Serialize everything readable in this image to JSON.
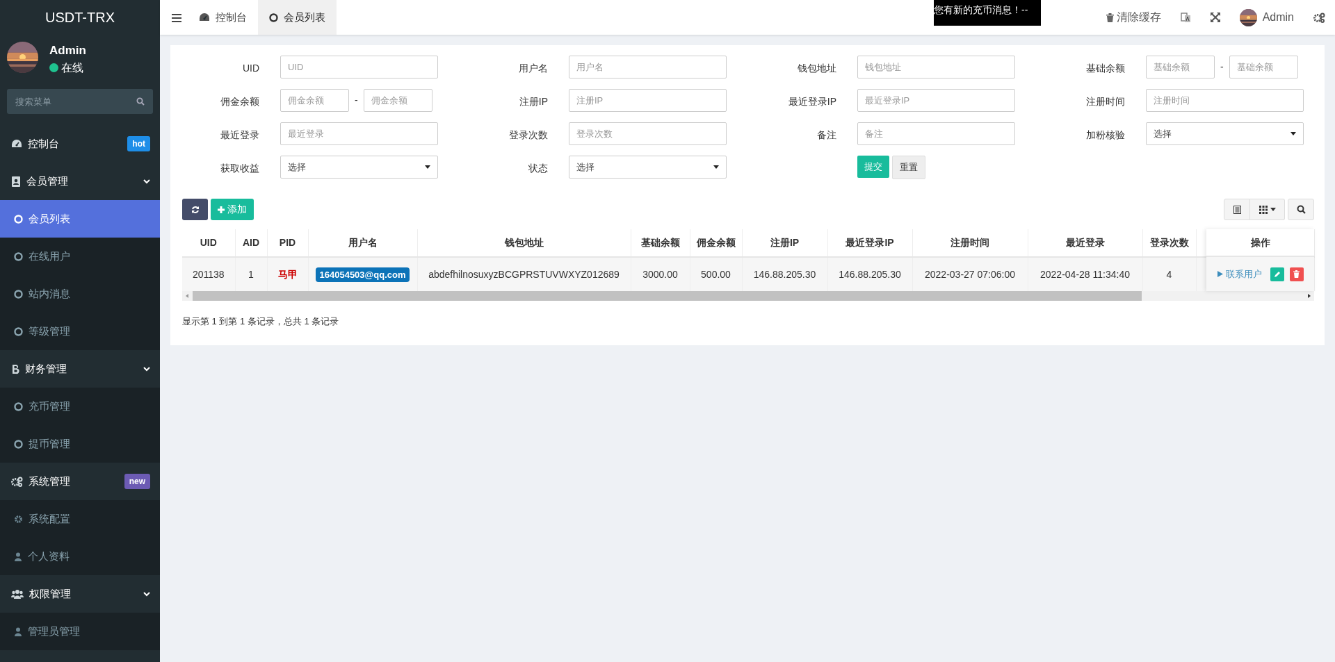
{
  "brand": "USDT-TRX",
  "user": {
    "name": "Admin",
    "status": "在线",
    "online": true
  },
  "sidebar_search": {
    "placeholder": "搜索菜单"
  },
  "sidebar": {
    "items": [
      {
        "kind": "item",
        "label": "控制台",
        "badge": "hot",
        "color": "#1e8ee8",
        "selected": false
      },
      {
        "kind": "group",
        "label": "会员管理",
        "expanded": true,
        "children": [
          {
            "label": "会员列表",
            "selected": true
          },
          {
            "label": "在线用户",
            "selected": false
          },
          {
            "label": "站内消息",
            "selected": false
          },
          {
            "label": "等级管理",
            "selected": false
          }
        ]
      },
      {
        "kind": "group",
        "label": "财务管理",
        "expanded": true,
        "children": [
          {
            "label": "充币管理",
            "selected": false
          },
          {
            "label": "提币管理",
            "selected": false
          }
        ]
      },
      {
        "kind": "group",
        "label": "系统管理",
        "badge": "new",
        "color": "#6c5bb4",
        "expanded": true,
        "children": [
          {
            "label": "系统配置",
            "selected": false
          },
          {
            "label": "个人资料",
            "selected": false
          }
        ]
      },
      {
        "kind": "group",
        "label": "权限管理",
        "expanded": true,
        "children": [
          {
            "label": "管理员管理",
            "selected": false
          }
        ]
      }
    ]
  },
  "tabs": [
    {
      "label": "控制台",
      "selected": false
    },
    {
      "label": "会员列表",
      "selected": true
    }
  ],
  "notification": "您有新的充币消息！--",
  "header_actions": {
    "clear_cache": "清除缓存",
    "user": "Admin"
  },
  "form": {
    "fields": [
      {
        "label": "UID",
        "kind": "text",
        "placeholder": "UID"
      },
      {
        "label": "用户名",
        "kind": "text",
        "placeholder": "用户名"
      },
      {
        "label": "钱包地址",
        "kind": "text",
        "placeholder": "钱包地址"
      },
      {
        "label": "基础余额",
        "kind": "range",
        "placeholders": [
          "基础余额",
          "基础余额"
        ],
        "separator": "-"
      },
      {
        "label": "佣金余额",
        "kind": "range",
        "placeholders": [
          "佣金余额",
          "佣金余额"
        ],
        "separator": "-"
      },
      {
        "label": "注册IP",
        "kind": "text",
        "placeholder": "注册IP"
      },
      {
        "label": "最近登录IP",
        "kind": "text",
        "placeholder": "最近登录IP"
      },
      {
        "label": "注册时间",
        "kind": "text",
        "placeholder": "注册时间"
      },
      {
        "label": "最近登录",
        "kind": "text",
        "placeholder": "最近登录"
      },
      {
        "label": "登录次数",
        "kind": "text",
        "placeholder": "登录次数"
      },
      {
        "label": "备注",
        "kind": "text",
        "placeholder": "备注"
      },
      {
        "label": "加粉核验",
        "kind": "select",
        "value": "选择"
      },
      {
        "label": "获取收益",
        "kind": "select",
        "value": "选择"
      },
      {
        "label": "状态",
        "kind": "select",
        "value": "选择"
      }
    ],
    "buttons": [
      {
        "kind": "submit",
        "label": "提交"
      },
      {
        "kind": "reset",
        "label": "重置"
      }
    ]
  },
  "toolbar": {
    "add": "添加"
  },
  "table": {
    "columns": [
      "UID",
      "AID",
      "PID",
      "用户名",
      "钱包地址",
      "基础余额",
      "佣金余额",
      "注册IP",
      "最近登录IP",
      "注册时间",
      "最近登录",
      "登录次数"
    ],
    "action_column": "操作",
    "rows": [
      {
        "cells": [
          {
            "kind": "text",
            "text": "201138"
          },
          {
            "kind": "text",
            "text": "1"
          },
          {
            "kind": "tag",
            "text": "马甲"
          },
          {
            "kind": "badge",
            "text": "164054503@qq.com"
          },
          {
            "kind": "text",
            "text": "abdefhilnosuxyzBCGPRSTUVWXYZ012689"
          },
          {
            "kind": "text",
            "text": "3000.00"
          },
          {
            "kind": "text",
            "text": "500.00"
          },
          {
            "kind": "text",
            "text": "146.88.205.30"
          },
          {
            "kind": "text",
            "text": "146.88.205.30"
          },
          {
            "kind": "text",
            "text": "2022-03-27 07:06:00"
          },
          {
            "kind": "text",
            "text": "2022-04-28 11:34:40"
          },
          {
            "kind": "text",
            "text": "4"
          }
        ],
        "actions": [
          {
            "kind": "link",
            "label": "联系用户"
          },
          {
            "kind": "edit"
          },
          {
            "kind": "delete"
          }
        ]
      }
    ]
  },
  "pagination_info": "显示第 1 到第 1 条记录，总共 1 条记录"
}
